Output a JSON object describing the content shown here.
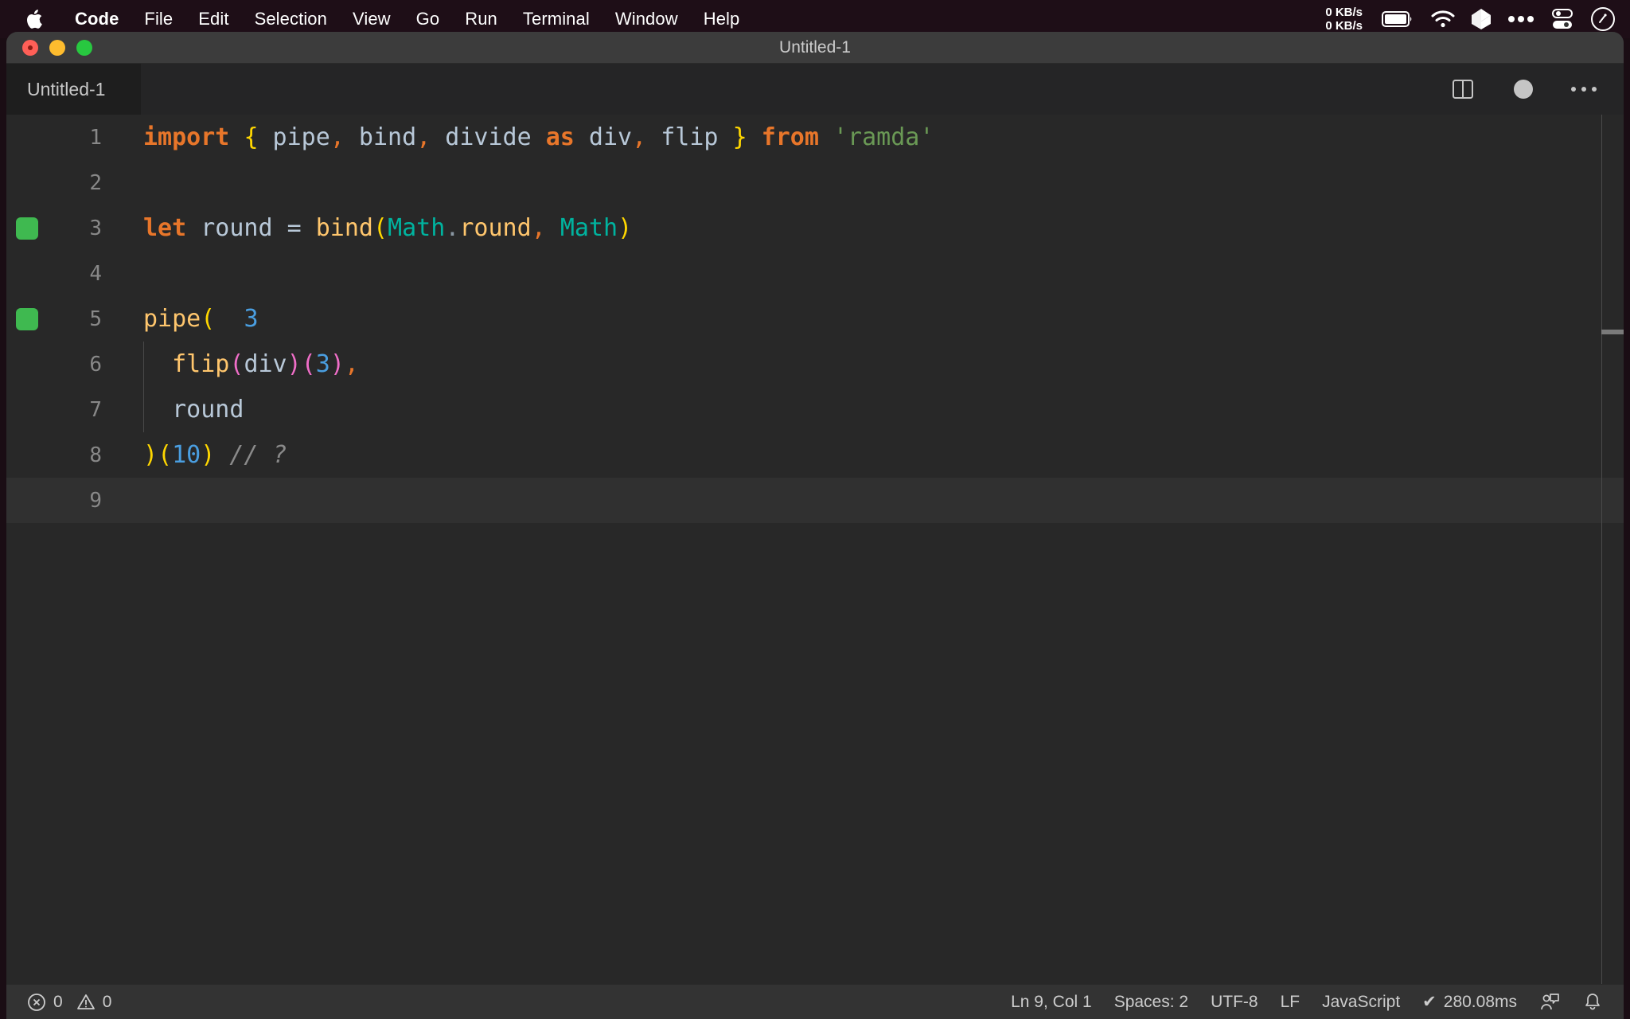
{
  "menubar": {
    "apple_icon": "apple-logo-icon",
    "items": [
      {
        "label": "Code",
        "bold": true
      },
      {
        "label": "File",
        "bold": false
      },
      {
        "label": "Edit",
        "bold": false
      },
      {
        "label": "Selection",
        "bold": false
      },
      {
        "label": "View",
        "bold": false
      },
      {
        "label": "Go",
        "bold": false
      },
      {
        "label": "Run",
        "bold": false
      },
      {
        "label": "Terminal",
        "bold": false
      },
      {
        "label": "Window",
        "bold": false
      },
      {
        "label": "Help",
        "bold": false
      }
    ],
    "network_up": "0 KB/s",
    "network_down": "0 KB/s",
    "tray_icons": [
      "battery-icon",
      "wifi-icon",
      "dropbox-icon",
      "ellipsis-icon",
      "control-center-icon",
      "siri-icon"
    ]
  },
  "window": {
    "title": "Untitled-1",
    "traffic_lights": [
      "close-button",
      "minimize-button",
      "maximize-button"
    ]
  },
  "tabbar": {
    "tab_label": "Untitled-1",
    "actions": [
      "split-editor-icon",
      "unsaved-indicator-icon",
      "more-actions-icon"
    ]
  },
  "editor": {
    "current_line": 9,
    "lines": [
      {
        "number": "1",
        "marker": false,
        "indent_guide": false,
        "tokens": [
          {
            "text": "import",
            "cls": "t-kw"
          },
          {
            "text": " ",
            "cls": "t-id"
          },
          {
            "text": "{",
            "cls": "t-brace"
          },
          {
            "text": " pipe",
            "cls": "t-id"
          },
          {
            "text": ",",
            "cls": "t-comma"
          },
          {
            "text": " bind",
            "cls": "t-id"
          },
          {
            "text": ",",
            "cls": "t-comma"
          },
          {
            "text": " divide ",
            "cls": "t-id"
          },
          {
            "text": "as",
            "cls": "t-kw"
          },
          {
            "text": " div",
            "cls": "t-id"
          },
          {
            "text": ",",
            "cls": "t-comma"
          },
          {
            "text": " flip ",
            "cls": "t-id"
          },
          {
            "text": "}",
            "cls": "t-brace"
          },
          {
            "text": " ",
            "cls": "t-id"
          },
          {
            "text": "from",
            "cls": "t-kw"
          },
          {
            "text": " ",
            "cls": "t-id"
          },
          {
            "text": "'ramda'",
            "cls": "t-str"
          }
        ]
      },
      {
        "number": "2",
        "marker": false,
        "indent_guide": false,
        "tokens": []
      },
      {
        "number": "3",
        "marker": true,
        "indent_guide": false,
        "tokens": [
          {
            "text": "let",
            "cls": "t-kw"
          },
          {
            "text": " round ",
            "cls": "t-id"
          },
          {
            "text": "=",
            "cls": "t-op"
          },
          {
            "text": " ",
            "cls": "t-id"
          },
          {
            "text": "bind",
            "cls": "t-fn"
          },
          {
            "text": "(",
            "cls": "t-paren-y"
          },
          {
            "text": "Math",
            "cls": "t-cls"
          },
          {
            "text": ".",
            "cls": "t-dot"
          },
          {
            "text": "round",
            "cls": "t-fn"
          },
          {
            "text": ",",
            "cls": "t-comma"
          },
          {
            "text": " ",
            "cls": "t-id"
          },
          {
            "text": "Math",
            "cls": "t-cls"
          },
          {
            "text": ")",
            "cls": "t-paren-y"
          }
        ]
      },
      {
        "number": "4",
        "marker": false,
        "indent_guide": false,
        "tokens": []
      },
      {
        "number": "5",
        "marker": true,
        "indent_guide": false,
        "tokens": [
          {
            "text": "pipe",
            "cls": "t-fn"
          },
          {
            "text": "(",
            "cls": "t-paren-y"
          },
          {
            "text": "  ",
            "cls": "t-id"
          },
          {
            "text": "3",
            "cls": "t-hint"
          }
        ]
      },
      {
        "number": "6",
        "marker": false,
        "indent_guide": true,
        "tokens": [
          {
            "text": "  ",
            "cls": "t-id"
          },
          {
            "text": "flip",
            "cls": "t-fn"
          },
          {
            "text": "(",
            "cls": "t-paren-m"
          },
          {
            "text": "div",
            "cls": "t-id"
          },
          {
            "text": ")",
            "cls": "t-paren-m"
          },
          {
            "text": "(",
            "cls": "t-paren-m"
          },
          {
            "text": "3",
            "cls": "t-num"
          },
          {
            "text": ")",
            "cls": "t-paren-m"
          },
          {
            "text": ",",
            "cls": "t-comma"
          }
        ]
      },
      {
        "number": "7",
        "marker": false,
        "indent_guide": true,
        "tokens": [
          {
            "text": "  round",
            "cls": "t-id"
          }
        ]
      },
      {
        "number": "8",
        "marker": false,
        "indent_guide": false,
        "tokens": [
          {
            "text": ")",
            "cls": "t-paren-y"
          },
          {
            "text": "(",
            "cls": "t-paren-y"
          },
          {
            "text": "10",
            "cls": "t-num"
          },
          {
            "text": ")",
            "cls": "t-paren-y"
          },
          {
            "text": " ",
            "cls": "t-id"
          },
          {
            "text": "// ?",
            "cls": "t-comment"
          }
        ]
      },
      {
        "number": "9",
        "marker": false,
        "indent_guide": false,
        "tokens": []
      }
    ]
  },
  "statusbar": {
    "errors_icon": "error-circle-icon",
    "errors": "0",
    "warnings_icon": "warning-triangle-icon",
    "warnings": "0",
    "cursor_position": "Ln 9, Col 1",
    "indentation": "Spaces: 2",
    "encoding": "UTF-8",
    "line_ending": "LF",
    "language": "JavaScript",
    "quokka_check": "✔",
    "quokka_time": "280.08ms",
    "feedback_icon": "feedback-person-icon",
    "bell_icon": "notifications-bell-icon"
  },
  "colors": {
    "menubar_bg": "#1e0e17",
    "titlebar_bg": "#3c3c3c",
    "tabbar_bg": "#252526",
    "tab_active_bg": "#1e1e1e",
    "editor_bg": "#282828",
    "statusbar_bg": "#333333",
    "marker_green": "#3fb950",
    "accent_yellow": "#ffd700",
    "accent_orange": "#e8762a"
  }
}
